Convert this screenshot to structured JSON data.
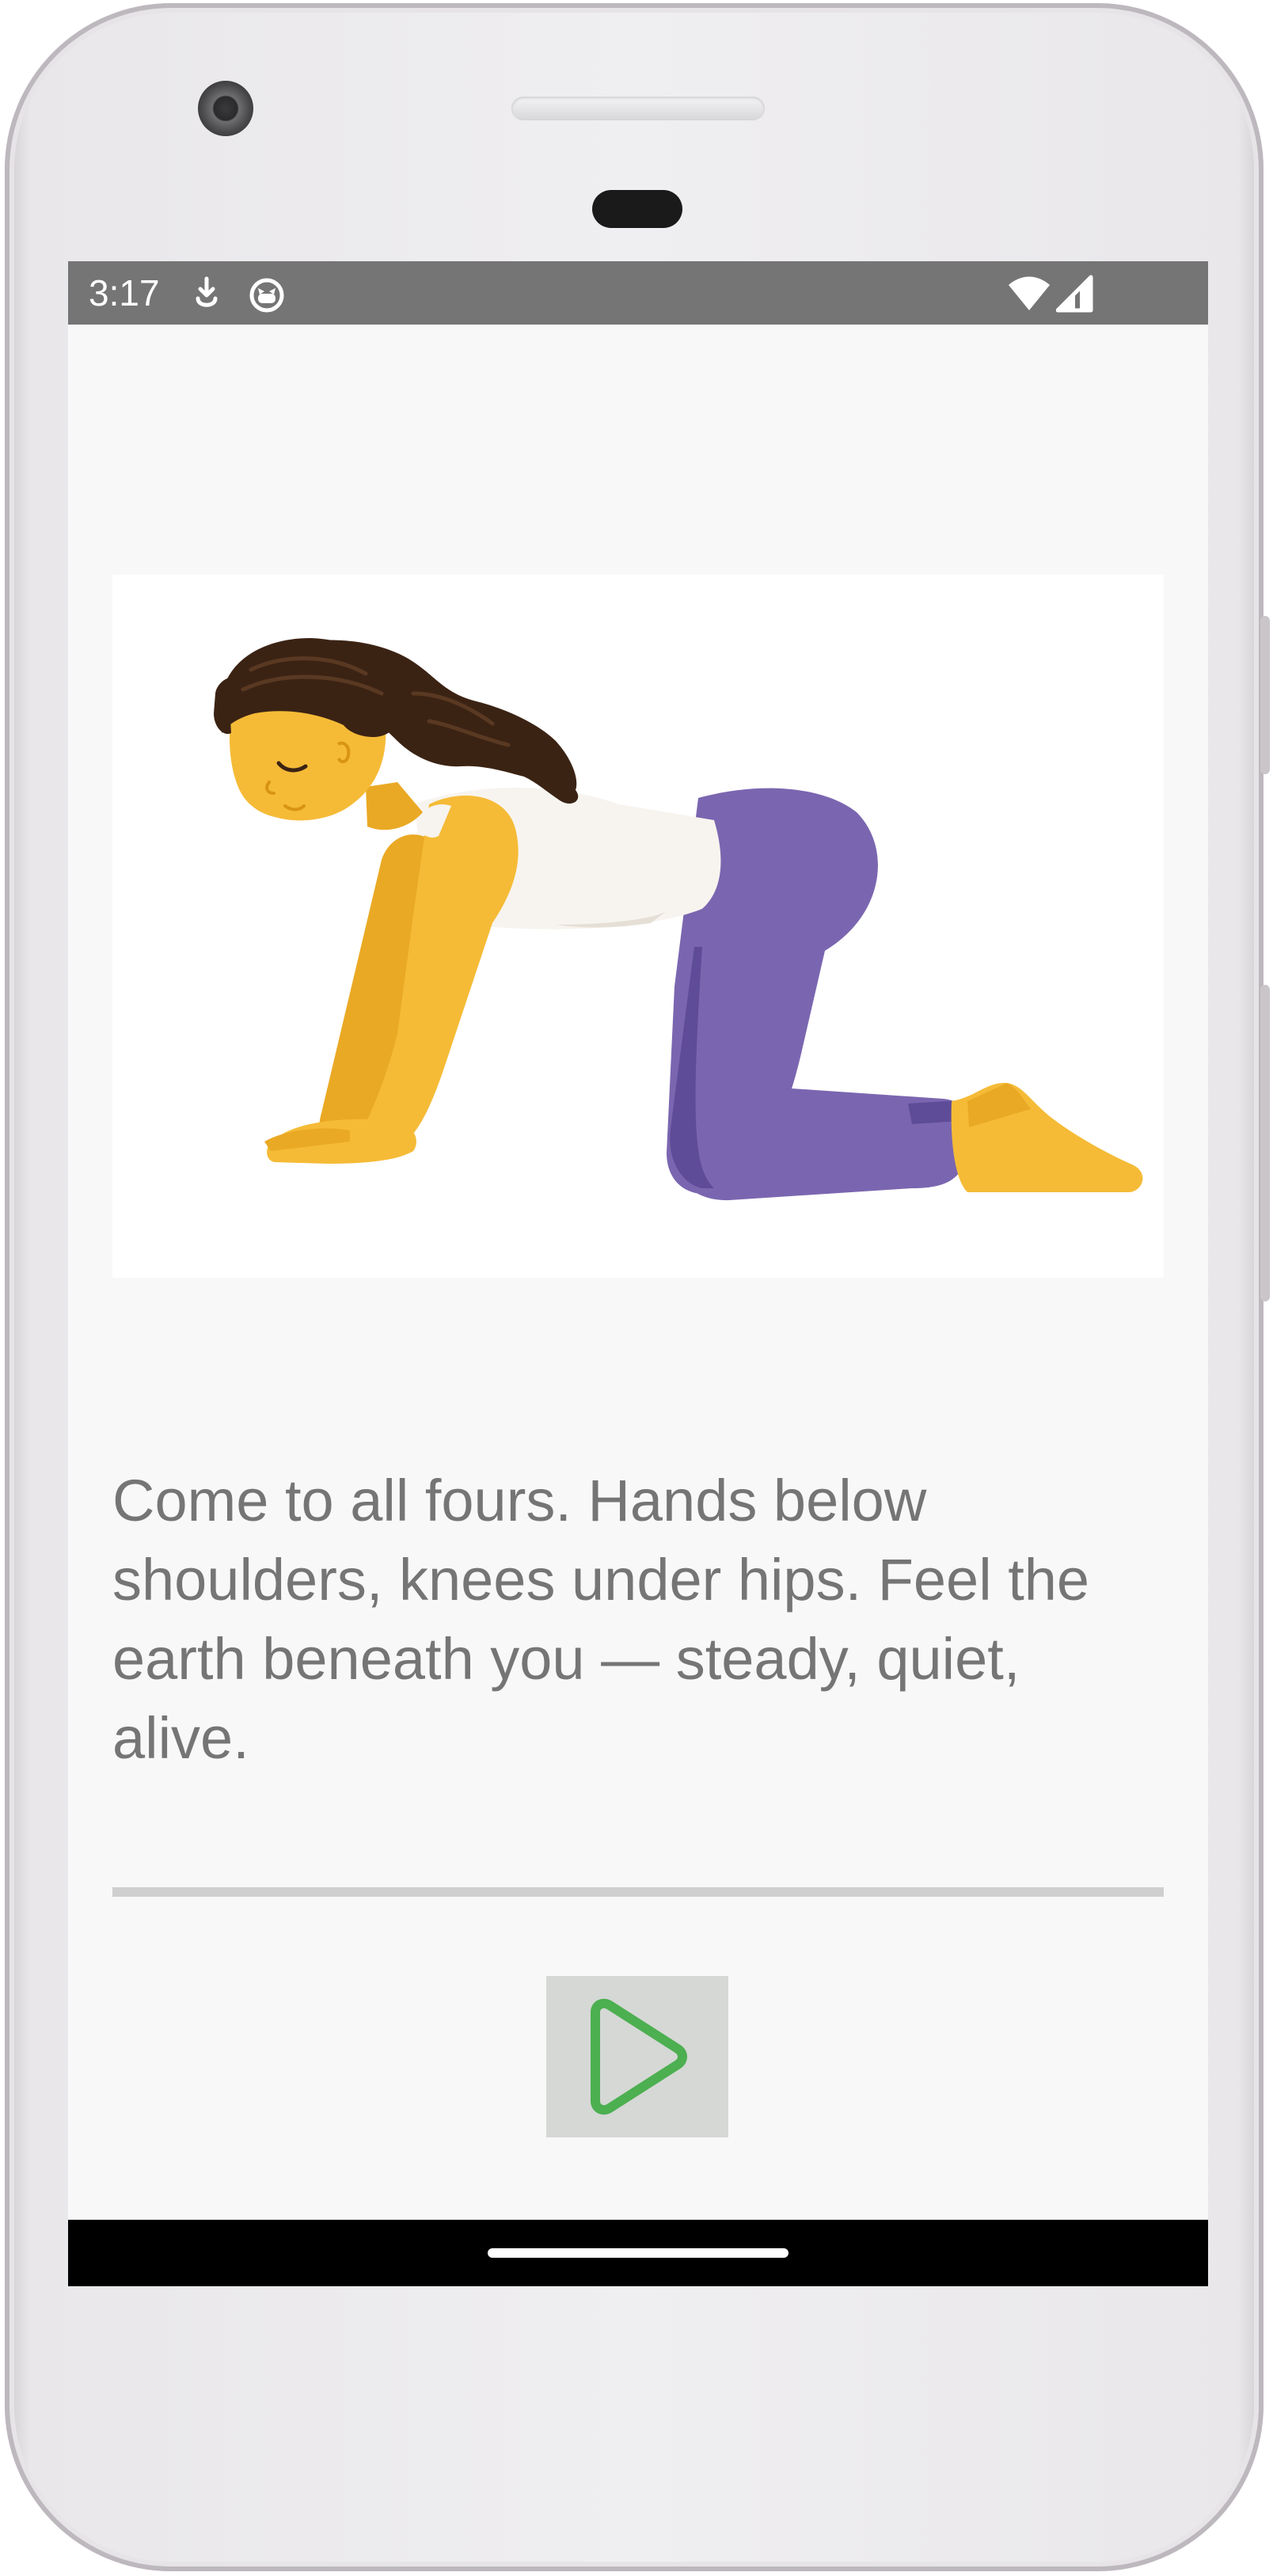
{
  "status_bar": {
    "time": "3:17",
    "notification_icons": [
      "download-icon",
      "cat-face-icon"
    ],
    "system_icons": [
      "wifi-icon",
      "signal-icon"
    ]
  },
  "pose": {
    "illustration_icon": "cat-pose-illustration",
    "instruction": "Come to all fours. Hands below shoulders, knees under hips. Feel the earth beneath you — steady, quiet, alive."
  },
  "controls": {
    "play_icon": "play-icon",
    "accent_color": "#4caf50"
  },
  "colors": {
    "status_bar": "#757575",
    "screen_background": "#f8f8f8",
    "caption_text": "#757575",
    "divider": "#cfcfcf",
    "play_button_bg": "#d5d8d5",
    "skin": "#f5bb37",
    "pants": "#7a66b0",
    "shirt": "#f7f4ef",
    "hair": "#3b2314"
  }
}
